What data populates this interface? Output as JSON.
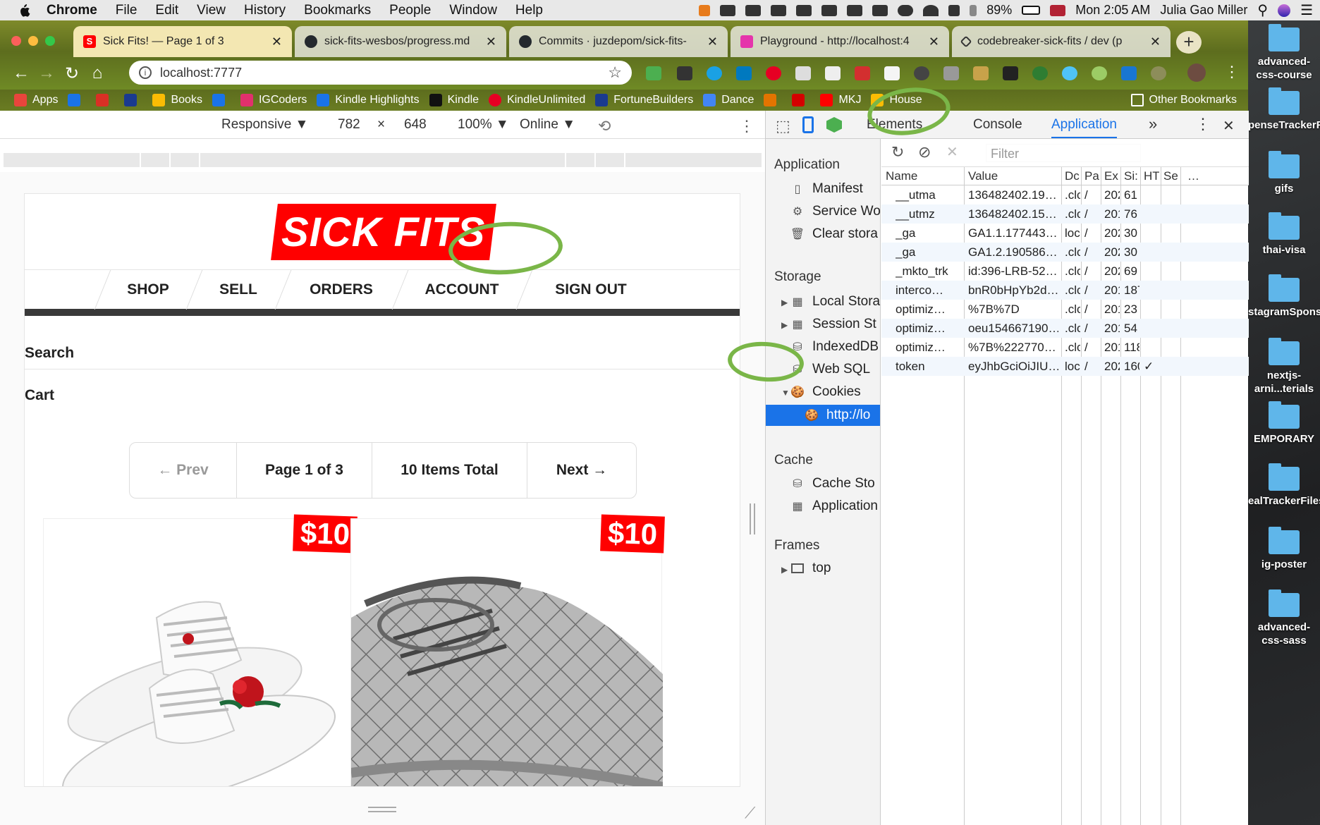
{
  "menubar": {
    "app": "Chrome",
    "items": [
      "File",
      "Edit",
      "View",
      "History",
      "Bookmarks",
      "People",
      "Window",
      "Help"
    ],
    "battery": "89%",
    "datetime": "Mon 2:05 AM",
    "user": "Julia Gao Miller"
  },
  "tabs": [
    {
      "title": "Sick Fits! — Page 1 of 3",
      "fav_color": "#ff0000",
      "fav_letter": "S"
    },
    {
      "title": "sick-fits-wesbos/progress.md",
      "fav_color": "#24292e",
      "fav_letter": ""
    },
    {
      "title": "Commits · juzdepom/sick-fits-",
      "fav_color": "#24292e",
      "fav_letter": ""
    },
    {
      "title": "Playground - http://localhost:4",
      "fav_color": "#e535ab",
      "fav_letter": ""
    },
    {
      "title": "codebreaker-sick-fits / dev (p",
      "fav_color": "#333333",
      "fav_letter": ""
    }
  ],
  "omnibox": {
    "url": "localhost:7777"
  },
  "bookmarks": [
    {
      "label": "Apps",
      "color": "#e8453c"
    },
    {
      "label": "",
      "color": "#1a73e8"
    },
    {
      "label": "",
      "color": "#d93025"
    },
    {
      "label": "",
      "color": "#1a3a8f"
    },
    {
      "label": "Books",
      "color": "#fbbc04"
    },
    {
      "label": "",
      "color": "#1a73e8"
    },
    {
      "label": "IGCoders",
      "color": "#e1306c"
    },
    {
      "label": "Kindle Highlights",
      "color": "#1a73e8"
    },
    {
      "label": "Kindle",
      "color": "#111111"
    },
    {
      "label": "KindleUnlimited",
      "color": "#e60023"
    },
    {
      "label": "FortuneBuilders",
      "color": "#1a3a8f"
    },
    {
      "label": "Dance",
      "color": "#4285f4"
    },
    {
      "label": "",
      "color": "#e37400"
    },
    {
      "label": "",
      "color": "#d50000"
    },
    {
      "label": "MKJ",
      "color": "#ff0000"
    },
    {
      "label": "House",
      "color": "#fbbc04"
    },
    {
      "label": "Other Bookmarks",
      "color": "#ffffff"
    }
  ],
  "responsive": {
    "mode": "Responsive",
    "width": "782",
    "x": "×",
    "height": "648",
    "zoom": "100%",
    "network": "Online"
  },
  "site": {
    "logo": "SICK FITS",
    "nav": [
      "SHOP",
      "SELL",
      "ORDERS",
      "ACCOUNT",
      "SIGN OUT"
    ],
    "search": "Search",
    "cart": "Cart",
    "pagination": {
      "prev": "← Prev",
      "page": "Page 1 of 3",
      "total": "10 Items Total",
      "next": "Next →"
    },
    "items": [
      {
        "price": "$10"
      },
      {
        "price": "$10"
      }
    ]
  },
  "devtools": {
    "tabs": [
      "Elements",
      "Console",
      "Application"
    ],
    "more": "»",
    "close": "✕",
    "sidebar": {
      "application_header": "Application",
      "application_items": [
        "Manifest",
        "Service Wo",
        "Clear stora"
      ],
      "storage_header": "Storage",
      "storage_items": [
        "Local Stora",
        "Session St",
        "IndexedDB",
        "Web SQL",
        "Cookies"
      ],
      "cookie_origin": "http://lo",
      "cache_header": "Cache",
      "cache_items": [
        "Cache Sto",
        "Application"
      ],
      "frames_header": "Frames",
      "frames_items": [
        "top"
      ]
    },
    "filter_placeholder": "Filter",
    "columns": [
      "Name",
      "Value",
      "Dc",
      "Pa",
      "Ex",
      "Si:",
      "HT",
      "Se",
      "…"
    ],
    "rows": [
      {
        "name": "__utma",
        "value": "136482402.19…",
        "domain": ".clc",
        "path": "/",
        "expires": "202",
        "size": "61",
        "http": ""
      },
      {
        "name": "__utmz",
        "value": "136482402.15…",
        "domain": ".clc",
        "path": "/",
        "expires": "201",
        "size": "76",
        "http": ""
      },
      {
        "name": "_ga",
        "value": "GA1.1.177443…",
        "domain": "loc",
        "path": "/",
        "expires": "202",
        "size": "30",
        "http": ""
      },
      {
        "name": "_ga",
        "value": "GA1.2.190586…",
        "domain": ".clc",
        "path": "/",
        "expires": "202",
        "size": "30",
        "http": ""
      },
      {
        "name": "_mkto_trk",
        "value": "id:396-LRB-52…",
        "domain": ".clc",
        "path": "/",
        "expires": "202",
        "size": "69",
        "http": ""
      },
      {
        "name": "interco…",
        "value": "bnR0bHpYb2d…",
        "domain": ".clc",
        "path": "/",
        "expires": "201",
        "size": "187",
        "http": ""
      },
      {
        "name": "optimiz…",
        "value": "%7B%7D",
        "domain": ".clc",
        "path": "/",
        "expires": "201",
        "size": "23",
        "http": ""
      },
      {
        "name": "optimiz…",
        "value": "oeu154667190…",
        "domain": ".clc",
        "path": "/",
        "expires": "201",
        "size": "54",
        "http": ""
      },
      {
        "name": "optimiz…",
        "value": "%7B%222770…",
        "domain": ".clc",
        "path": "/",
        "expires": "201",
        "size": "118",
        "http": ""
      },
      {
        "name": "token",
        "value": "eyJhbGciOiJIU…",
        "domain": "loc",
        "path": "/",
        "expires": "202",
        "size": "160",
        "http": "✓"
      }
    ]
  },
  "desktop": [
    {
      "label": "advanced-css-course"
    },
    {
      "label": "penseTrackerFiles"
    },
    {
      "label": "gifs"
    },
    {
      "label": "thai-visa"
    },
    {
      "label": "stagramSponsors"
    },
    {
      "label": "nextjs-arni...terials"
    },
    {
      "label": "EMPORARY"
    },
    {
      "label": "ealTrackerFiles"
    },
    {
      "label": "ig-poster"
    },
    {
      "label": "advanced-css-sass"
    }
  ],
  "colors": {
    "highlight": "#7ab648",
    "brand_red": "#ff0000",
    "devtools_selected": "#1a73e8"
  }
}
